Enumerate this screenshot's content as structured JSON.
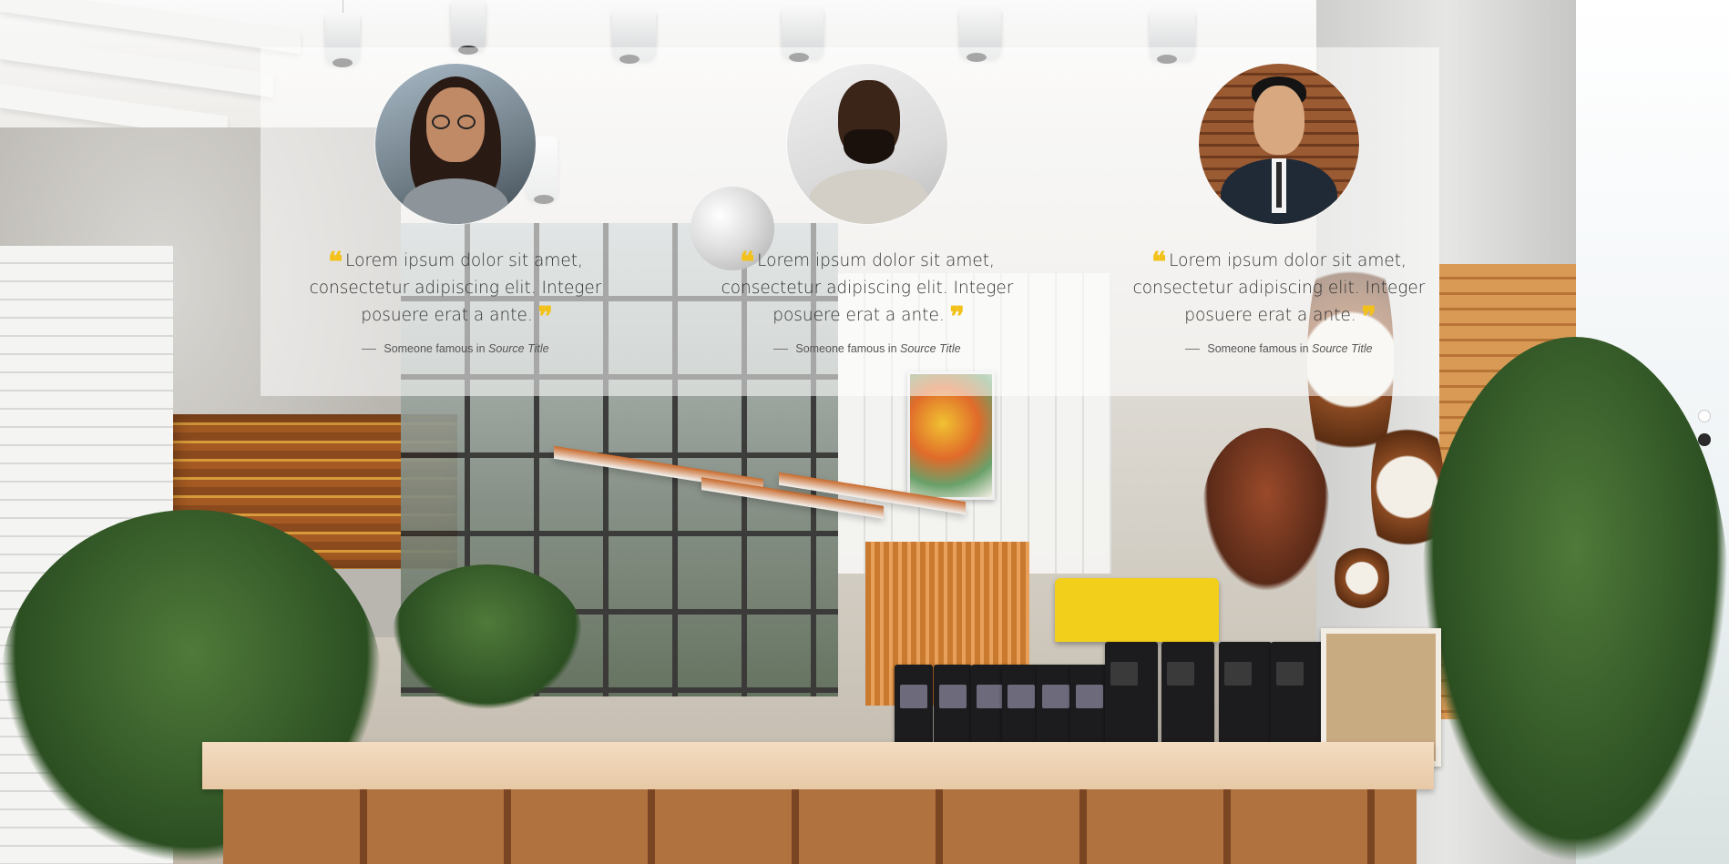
{
  "testimonials": [
    {
      "avatar": "woman-with-glasses-portrait",
      "open_quote": "❝",
      "quote": "Lorem ipsum dolor sit amet, consectetur adipiscing elit. Integer posuere erat a ante.",
      "close_quote": "❞",
      "attribution": "Someone famous in",
      "source_title": "Source Title"
    },
    {
      "avatar": "smiling-man-beard-portrait",
      "open_quote": "❝",
      "quote": "Lorem ipsum dolor sit amet, consectetur adipiscing elit. Integer posuere erat a ante.",
      "close_quote": "❞",
      "attribution": "Someone famous in",
      "source_title": "Source Title"
    },
    {
      "avatar": "man-in-suit-portrait",
      "open_quote": "❝",
      "quote": "Lorem ipsum dolor sit amet, consectetur adipiscing elit. Integer posuere erat a ante.",
      "close_quote": "❞",
      "attribution": "Someone famous in",
      "source_title": "Source Title"
    }
  ],
  "slider": {
    "slide_count": 2,
    "active_slide": 2
  },
  "colors": {
    "accent": "#f3c21a",
    "band": "#ffffff",
    "text": "#333333"
  }
}
